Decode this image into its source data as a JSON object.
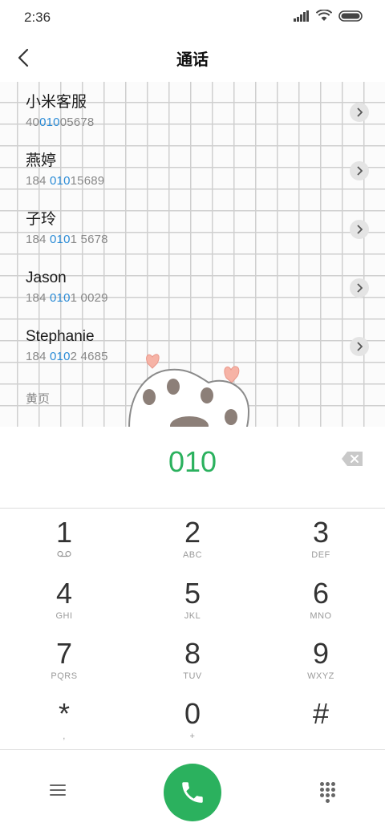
{
  "status": {
    "time": "2:36"
  },
  "header": {
    "title": "通话"
  },
  "contacts": [
    {
      "name": "小米客服",
      "num_pre": "40",
      "num_match": "010",
      "num_post": "05678"
    },
    {
      "name": "燕婷",
      "num_pre": "184 ",
      "num_match": "010",
      "num_post": "15689"
    },
    {
      "name": "子玲",
      "num_pre": "184 ",
      "num_match": "010",
      "num_post": "1 5678"
    },
    {
      "name": "Jason",
      "num_pre": "184 ",
      "num_match": "010",
      "num_post": "1 0029"
    },
    {
      "name": "Stephanie",
      "num_pre": "184 ",
      "num_match": "010",
      "num_post": "2 4685"
    }
  ],
  "yellow_pages_label": "黄页",
  "dial": {
    "number": "010"
  },
  "keys": [
    {
      "digit": "1",
      "letters": ""
    },
    {
      "digit": "2",
      "letters": "ABC"
    },
    {
      "digit": "3",
      "letters": "DEF"
    },
    {
      "digit": "4",
      "letters": "GHI"
    },
    {
      "digit": "5",
      "letters": "JKL"
    },
    {
      "digit": "6",
      "letters": "MNO"
    },
    {
      "digit": "7",
      "letters": "PQRS"
    },
    {
      "digit": "8",
      "letters": "TUV"
    },
    {
      "digit": "9",
      "letters": "WXYZ"
    },
    {
      "digit": "*",
      "letters": ","
    },
    {
      "digit": "0",
      "letters": "+"
    },
    {
      "digit": "#",
      "letters": ""
    }
  ],
  "colors": {
    "accent": "#2bb15e",
    "match": "#2a8bd6"
  },
  "icons": {
    "voicemail": "voicemail-icon",
    "call": "phone-icon",
    "backspace": "backspace-icon",
    "menu": "menu-icon",
    "keypad": "keypad-icon"
  }
}
